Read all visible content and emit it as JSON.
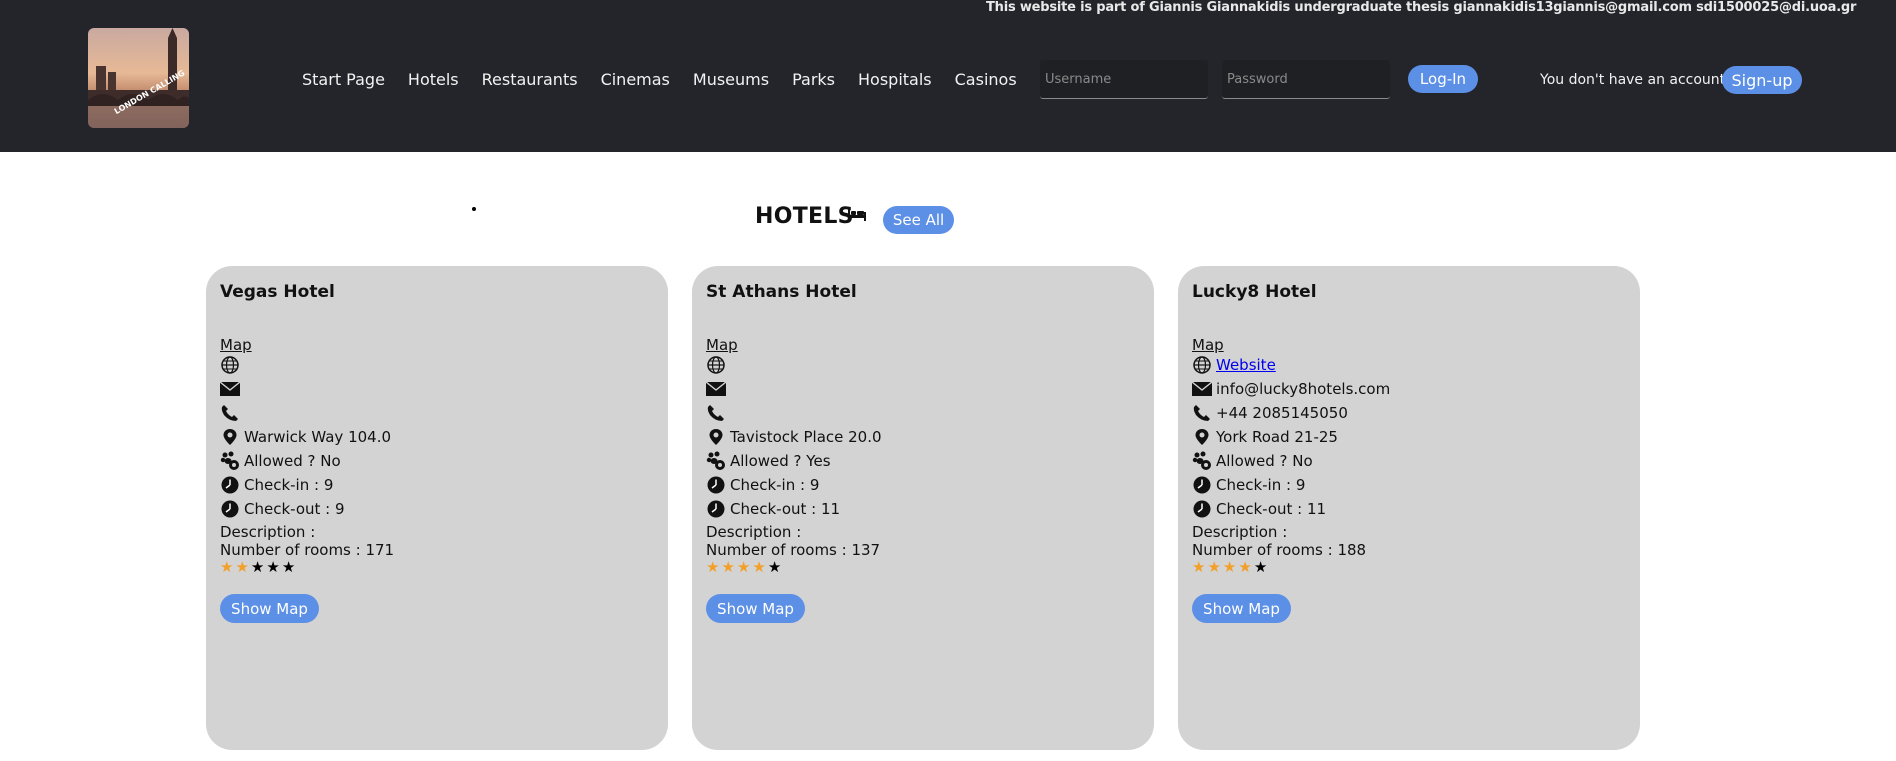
{
  "header": {
    "thesis_note": "This website is part of Giannis Giannakidis undergraduate thesis giannakidis13giannis@gmail.com sdi1500025@di.uoa.gr",
    "logo_text": "LONDON CALLING",
    "nav": [
      "Start Page",
      "Hotels",
      "Restaurants",
      "Cinemas",
      "Museums",
      "Parks",
      "Hospitals",
      "Casinos"
    ],
    "username_placeholder": "Username",
    "password_placeholder": "Password",
    "login_label": "Log-In",
    "no_account_text": "You don't have an account?",
    "signup_label": "Sign-up"
  },
  "section": {
    "title": "HOTELS",
    "see_all_label": "See All"
  },
  "hotels": [
    {
      "name": "Vegas Hotel",
      "map_link": "Map",
      "website": "",
      "email": "",
      "phone": "",
      "address": "Warwick Way 104.0",
      "pets": "Allowed ? No",
      "checkin": "Check-in : 9",
      "checkout": "Check-out : 9",
      "description": "Description :",
      "rooms": "Number of rooms : 171",
      "rating": 2,
      "show_map_label": "Show Map"
    },
    {
      "name": "St Athans Hotel",
      "map_link": "Map",
      "website": "",
      "email": "",
      "phone": "",
      "address": "Tavistock Place 20.0",
      "pets": "Allowed ? Yes",
      "checkin": "Check-in : 9",
      "checkout": "Check-out : 11",
      "description": "Description :",
      "rooms": "Number of rooms : 137",
      "rating": 4,
      "show_map_label": "Show Map"
    },
    {
      "name": "Lucky8 Hotel",
      "map_link": "Map",
      "website": "Website",
      "email": "info@lucky8hotels.com",
      "phone": "+44 2085145050",
      "address": "York Road 21-25",
      "pets": "Allowed ? No",
      "checkin": "Check-in : 9",
      "checkout": "Check-out : 11",
      "description": "Description :",
      "rooms": "Number of rooms : 188",
      "rating": 4,
      "show_map_label": "Show Map"
    }
  ],
  "colors": {
    "header_bg": "#24252b",
    "accent": "#5c8fe6",
    "card_bg": "#d3d3d3",
    "star_on": "#f2a02a",
    "star_off": "#000000"
  },
  "icons": [
    "globe-icon",
    "envelope-icon",
    "phone-icon",
    "location-pin-icon",
    "paw-icon",
    "clock-icon",
    "bed-icon",
    "star-icon"
  ]
}
